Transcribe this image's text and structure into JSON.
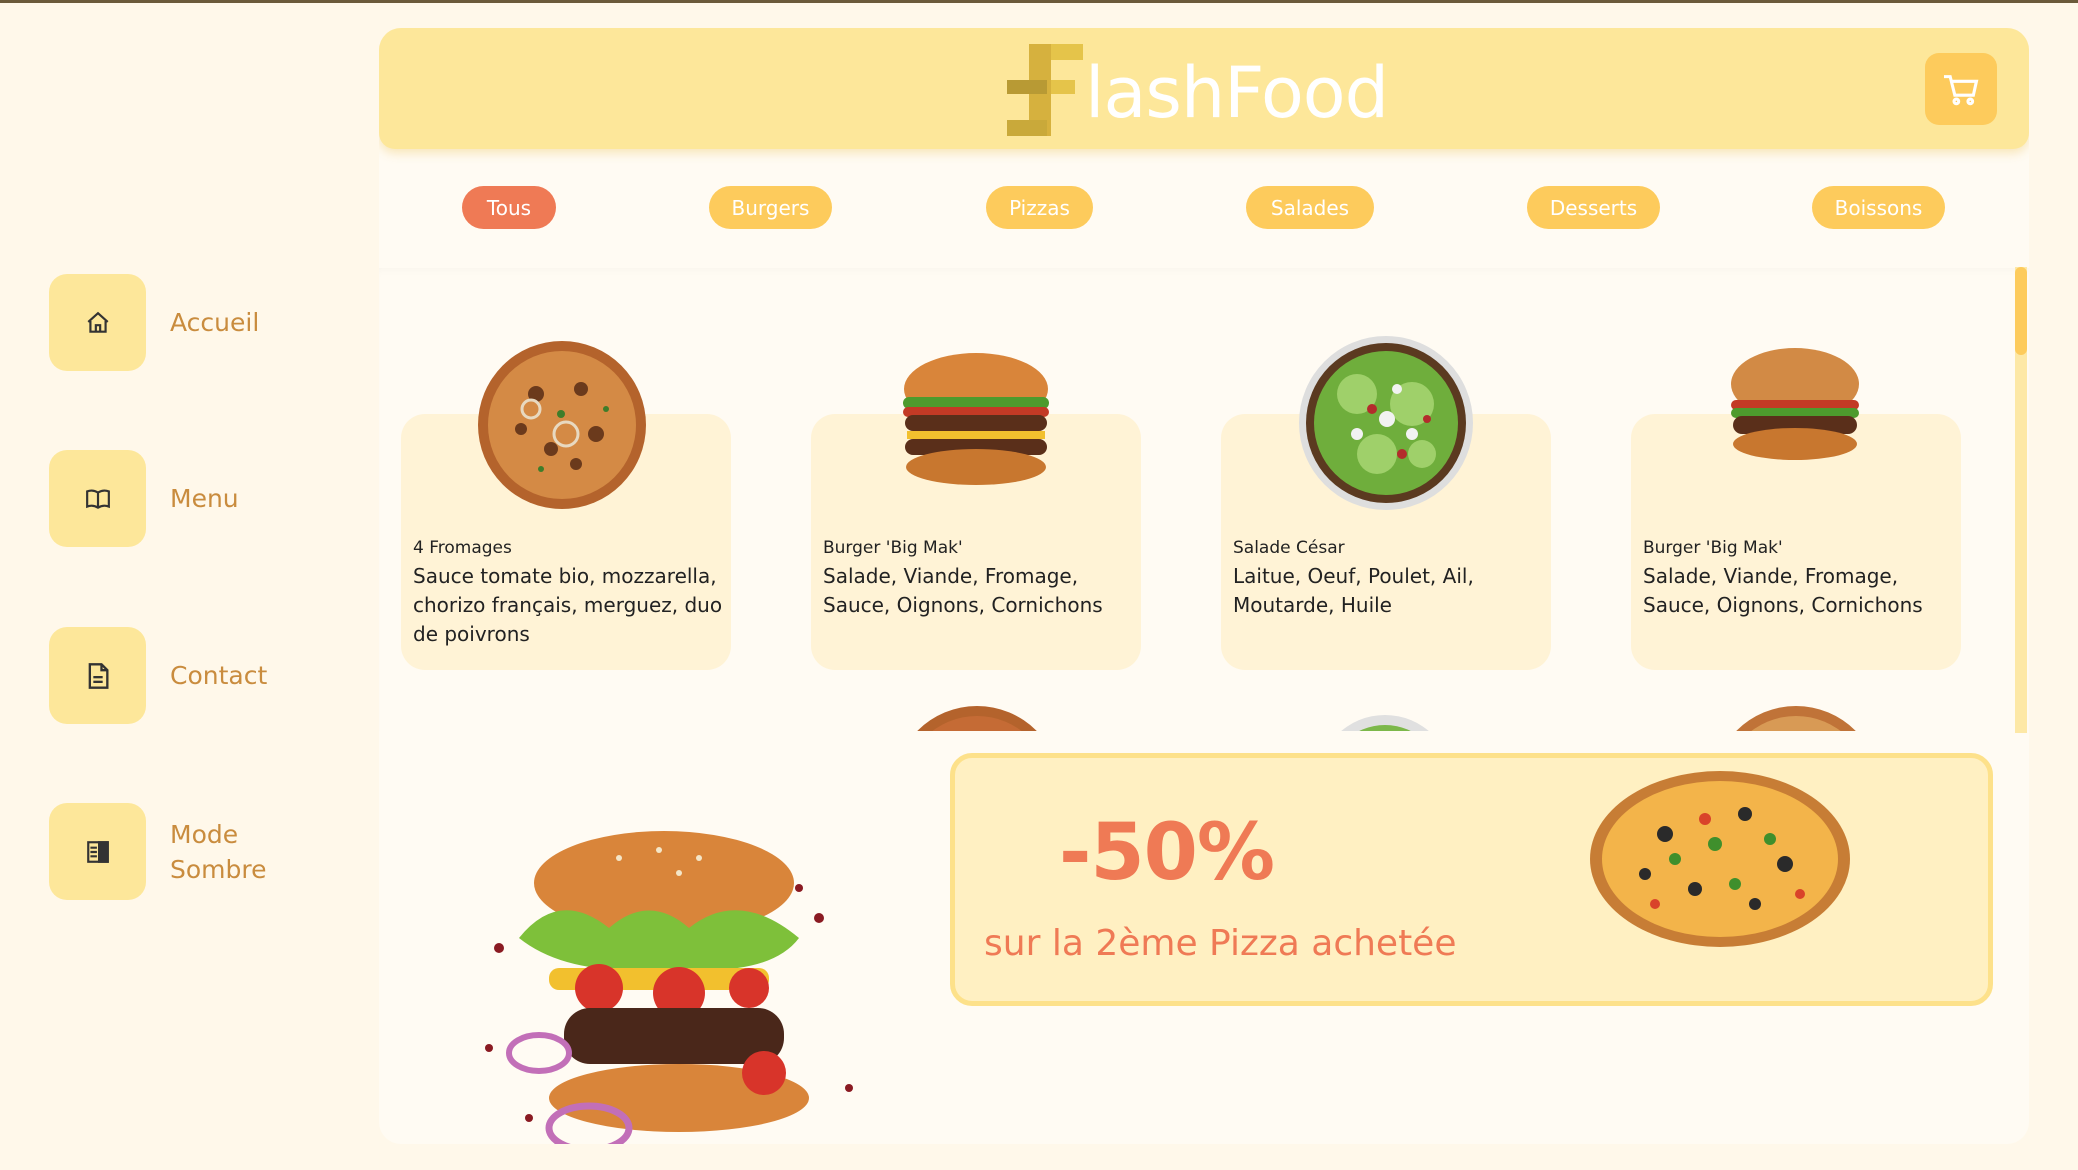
{
  "brand": {
    "name_rest": "lashFood",
    "accent": "#fde79a",
    "orange": "#ef7a55",
    "gold": "#fdcb5c"
  },
  "sidebar": {
    "items": [
      {
        "label": "Accueil",
        "icon": "home-icon"
      },
      {
        "label": "Menu",
        "icon": "book-icon"
      },
      {
        "label": "Contact",
        "icon": "document-icon"
      },
      {
        "label": "Mode Sombre",
        "icon": "dark-mode-icon"
      }
    ]
  },
  "header": {
    "cart_icon": "cart-icon"
  },
  "tabs": [
    "Tous",
    "Burgers",
    "Pizzas",
    "Salades",
    "Desserts",
    "Boissons"
  ],
  "products": [
    {
      "title": "4 Fromages",
      "desc": "Sauce tomate bio, mozzarella, chorizo français, merguez, duo de poivrons",
      "image": "pizza"
    },
    {
      "title": "Burger 'Big Mak'",
      "desc": "Salade, Viande, Fromage, Sauce, Oignons, Cornichons",
      "image": "burger-tall"
    },
    {
      "title": "Salade César",
      "desc": "Laitue, Oeuf, Poulet, Ail, Moutarde, Huile",
      "image": "salad"
    },
    {
      "title": "Burger 'Big Mak'",
      "desc": "Salade, Viande, Fromage, Sauce, Oignons, Cornichons",
      "image": "burger"
    }
  ],
  "promo": {
    "percent": "-50%",
    "text": "sur la 2ème Pizza achetée"
  }
}
